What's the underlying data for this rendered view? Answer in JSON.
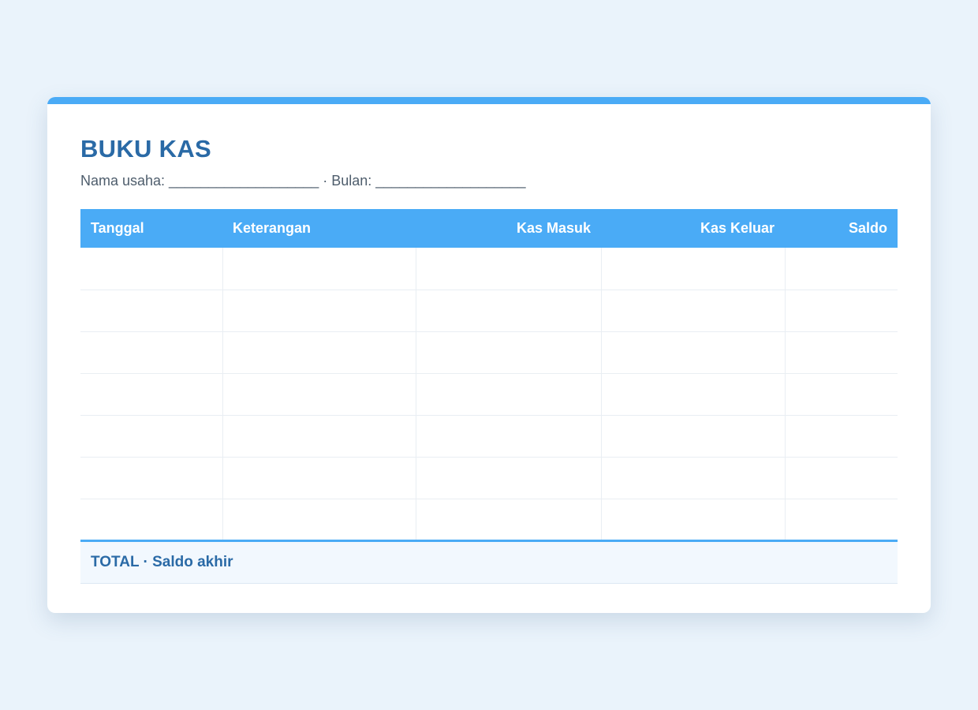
{
  "document": {
    "title": "BUKU KAS",
    "subtitle": "Nama usaha: ___________________ · Bulan: ___________________"
  },
  "table": {
    "columns": [
      "Tanggal",
      "Keterangan",
      "Kas Masuk",
      "Kas Keluar",
      "Saldo"
    ],
    "rows": [
      [
        "",
        "",
        "",
        "",
        ""
      ],
      [
        "",
        "",
        "",
        "",
        ""
      ],
      [
        "",
        "",
        "",
        "",
        ""
      ],
      [
        "",
        "",
        "",
        "",
        ""
      ],
      [
        "",
        "",
        "",
        "",
        ""
      ],
      [
        "",
        "",
        "",
        "",
        ""
      ],
      [
        "",
        "",
        "",
        "",
        ""
      ]
    ],
    "footer_label": "TOTAL · Saldo akhir"
  },
  "colors": {
    "background": "#eaf3fb",
    "accent": "#4aabf6",
    "title": "#2a6aa6",
    "footer_background": "#f2f8fe"
  }
}
